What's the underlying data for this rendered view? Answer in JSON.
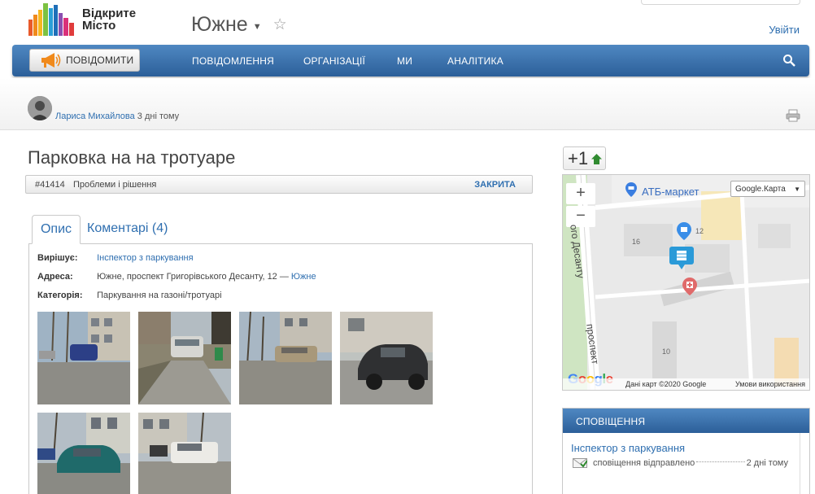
{
  "header": {
    "logo_line1": "Відкрите",
    "logo_line2": "Місто",
    "city": "Южне",
    "login": "Увійти"
  },
  "navbar": {
    "report_label": "ПОВІДОМИТИ",
    "items": [
      "ПОВІДОМЛЕННЯ",
      "ОРГАНІЗАЦІЇ",
      "МИ",
      "АНАЛІТИКА"
    ]
  },
  "author": {
    "name": "Лариса Михайлова",
    "time": "3 дні тому"
  },
  "issue": {
    "title": "Парковка на на тротуаре",
    "number": "#41414",
    "category": "Проблеми і рішення",
    "status": "ЗАКРИТА"
  },
  "tabs": {
    "description": "Опис",
    "comments": "Коментарі (4)"
  },
  "details": {
    "resolver_label": "Вирішує:",
    "resolver": "Інспектор з паркування",
    "address_label": "Адреса:",
    "address": "Южне, проспект Григорівського Десанту, 12 —",
    "address_city": "Южне",
    "category_label": "Категорія:",
    "category": "Паркування на газоні/тротуарі"
  },
  "votes": {
    "label": "+1"
  },
  "map": {
    "zoom_in": "+",
    "zoom_out": "−",
    "type": "Google.Карта",
    "poi": "АТБ-маркет",
    "road1": "ого Десанту",
    "road2": "проспект",
    "nums": [
      "16",
      "12",
      "10"
    ],
    "attribution": "Дані карт ©2020 Google",
    "terms": "Умови використання",
    "logo": "Google"
  },
  "notifications": {
    "heading": "СПОВІЩЕННЯ",
    "who": "Інспектор з паркування",
    "text": "сповіщення відправлено",
    "time": "2 дні тому"
  },
  "colors": {
    "nav_blue": "#2c5f99",
    "link_blue": "#2f6fb0",
    "accent_orange": "#f08a1c",
    "vote_green": "#2f8a2f"
  }
}
